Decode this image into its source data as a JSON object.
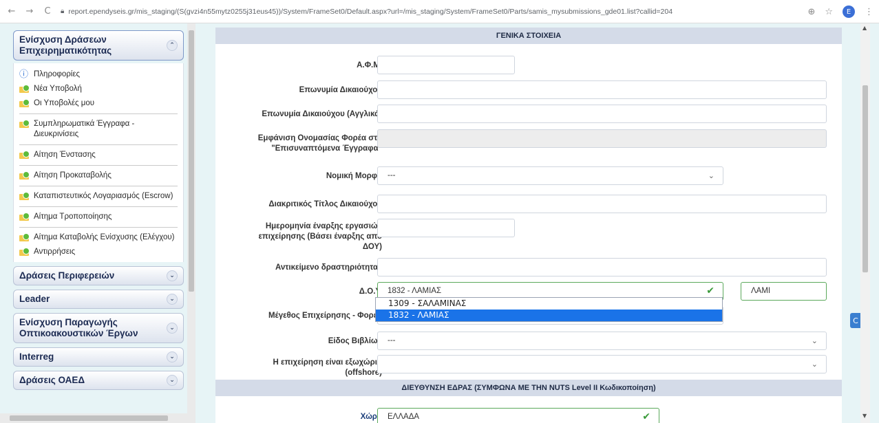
{
  "browser": {
    "url": "report.ependyseis.gr/mis_staging/(S(gvzi4n55mytz0255j31eus45))/System/FrameSet0/Default.aspx?url=/mis_staging/System/FrameSet0/Parts/samis_mysubmissions_gde01.list?callid=204",
    "profile_initial": "E"
  },
  "sidebar": {
    "sections": [
      {
        "title": "Ενίσχυση Δράσεων Επιχειρηματικότητας",
        "expanded": true,
        "items": [
          {
            "label": "Πληροφορίες",
            "icon": "info-icon"
          },
          {
            "label": "Νέα Υποβολή",
            "icon": "folder-icon"
          },
          {
            "label": "Οι Υποβολές μου",
            "icon": "folder-icon"
          },
          {
            "label": "Συμπληρωματικά Έγγραφα - Διευκρινίσεις",
            "icon": "folder-icon"
          },
          {
            "label": "Αίτηση Ένστασης",
            "icon": "folder-icon"
          },
          {
            "label": "Αίτηση Προκαταβολής",
            "icon": "folder-icon"
          },
          {
            "label": "Καταπιστευτικός Λογαριασμός (Escrow)",
            "icon": "folder-icon"
          },
          {
            "label": "Αίτημα Τροποποίησης",
            "icon": "folder-icon"
          },
          {
            "label": "Αίτημα Καταβολής Ενίσχυσης (Ελέγχου)",
            "icon": "folder-icon"
          },
          {
            "label": "Αντιρρήσεις",
            "icon": "folder-icon"
          }
        ]
      },
      {
        "title": "Δράσεις Περιφερειών",
        "expanded": false
      },
      {
        "title": "Leader",
        "expanded": false
      },
      {
        "title": "Ενίσχυση Παραγωγής Οπτικοακουστικών Έργων",
        "expanded": false
      },
      {
        "title": "Interreg",
        "expanded": false
      },
      {
        "title": "Δράσεις ΟΑΕΔ",
        "expanded": false
      }
    ]
  },
  "form": {
    "section_general": "ΓΕΝΙΚΑ ΣΤΟΙΧΕΙΑ",
    "section_address": "ΔΙΕΥΘΥΝΣΗ ΕΔΡΑΣ (ΣΥΜΦΩΝΑ ΜΕ ΤΗΝ NUTS Level II Κωδικοποίηση)",
    "fields": {
      "afm": {
        "label": "Α.Φ.Μ.",
        "value": ""
      },
      "eponymia": {
        "label": "Επωνυμία Δικαιούχου",
        "value": ""
      },
      "eponymia_en": {
        "label": "Επωνυμία Δικαιούχου (Αγγλικά)",
        "value": ""
      },
      "emfanisi": {
        "label": "Εμφάνιση Ονομασίας Φορέα στα \"Επισυναπτόμενα Έγγραφα\"",
        "value": ""
      },
      "nomiki_morfi": {
        "label": "Νομική Μορφή",
        "value": "---"
      },
      "diakritikos": {
        "label": "Διακριτικός Τίτλος Δικαιούχου",
        "value": ""
      },
      "imerominia": {
        "label": "Ημερομηνία έναρξης εργασιών επιχείρησης (Βάσει έναρξης απο ΔΟΥ)",
        "value": ""
      },
      "antikeimeno": {
        "label": "Αντικείμενο δραστηριότητας",
        "value": ""
      },
      "doy": {
        "label": "Δ.Ο.Υ.",
        "value": "1832 - ΛΑΜΙΑΣ",
        "filter": "ΛΑΜΙ",
        "options": [
          "1309 - ΣΑΛΑΜΙΝΑΣ",
          "1832 - ΛΑΜΙΑΣ"
        ],
        "selected_index": 1
      },
      "megethos": {
        "label": "Μέγεθος Επιχείρησης - Φορέα",
        "value": ""
      },
      "eidos_vivlion": {
        "label": "Είδος Βιβλίων",
        "value": "---"
      },
      "offshore": {
        "label": "Η επιχείρηση είναι εξωχώρια (offshore)",
        "value": ""
      },
      "xora": {
        "label": "Χώρα",
        "value": "ΕΛΛΑΔΑ"
      }
    }
  },
  "colors": {
    "accent": "#1a73e8",
    "valid": "#5aa85a",
    "page_bg": "#e7f4f6",
    "section_bg": "#d4dbe8"
  }
}
